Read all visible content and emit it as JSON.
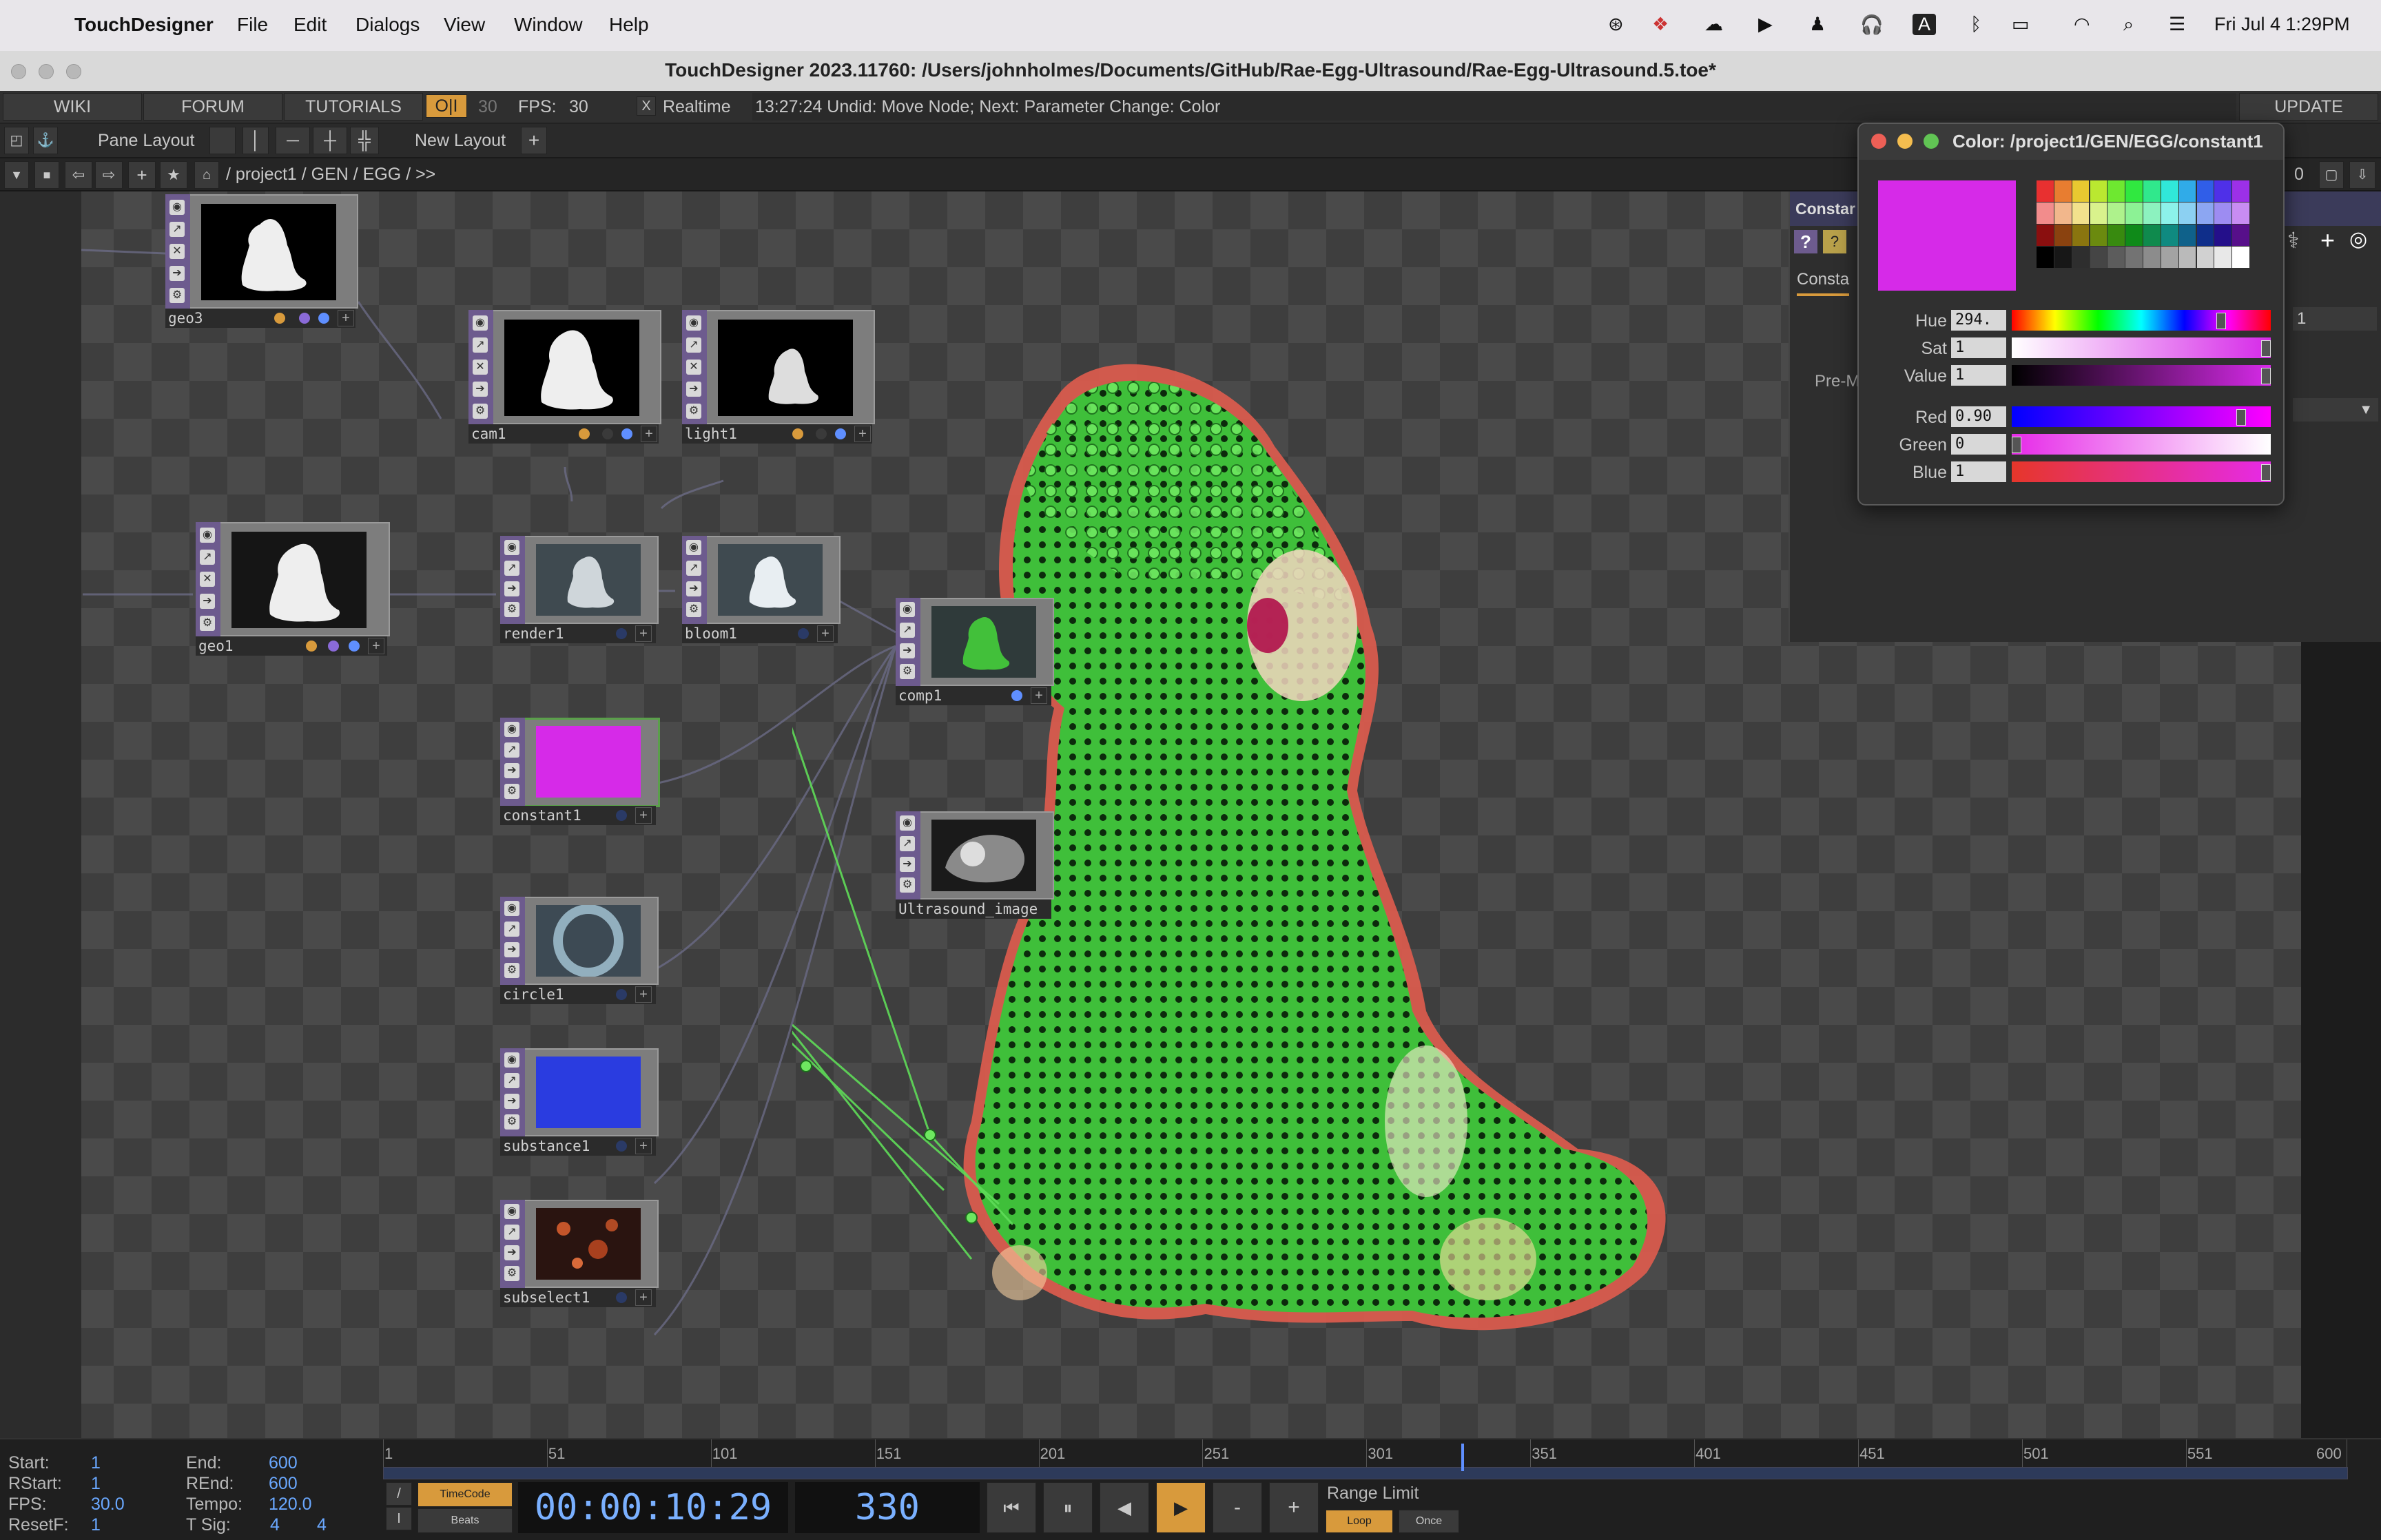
{
  "menubar": {
    "app_name": "TouchDesigner",
    "menus": [
      "File",
      "Edit",
      "Dialogs",
      "View",
      "Window",
      "Help"
    ],
    "clock": "Fri Jul 4  1:29PM",
    "input_indicator": "A"
  },
  "window": {
    "title": "TouchDesigner 2023.11760: /Users/johnholmes/Documents/GitHub/Rae-Egg-Ultrasound/Rae-Egg-Ultrasound.5.toe*"
  },
  "toolbar1": {
    "wiki": "WIKI",
    "forum": "FORUM",
    "tutorials": "TUTORIALS",
    "oi": "O|I",
    "fps_target": "30",
    "fps_label": "FPS:",
    "fps_value": "30",
    "realtime_check": "X",
    "realtime": "Realtime",
    "status": "13:27:24 Undid: Move Node; Next: Parameter Change: Color",
    "update": "UPDATE"
  },
  "toolbar2": {
    "pane_layout": "Pane Layout",
    "new_layout": "New Layout",
    "add": "+"
  },
  "toolbar3": {
    "path": "/ project1 / GEN / EGG / >>",
    "right_value": "0"
  },
  "nodes": [
    {
      "name": "geo3"
    },
    {
      "name": "cam1"
    },
    {
      "name": "light1"
    },
    {
      "name": "geo1"
    },
    {
      "name": "render1"
    },
    {
      "name": "bloom1"
    },
    {
      "name": "comp1"
    },
    {
      "name": "constant1"
    },
    {
      "name": "Ultrasound_image"
    },
    {
      "name": "circle1"
    },
    {
      "name": "substance1"
    },
    {
      "name": "subselect1"
    }
  ],
  "color_dialog": {
    "title": "Color:  /project1/GEN/EGG/constant1",
    "swatch_color": "#d62ae8",
    "rows": [
      {
        "label": "Hue",
        "value": "294.",
        "fraction": 0.82
      },
      {
        "label": "Sat",
        "value": "1",
        "fraction": 1.0
      },
      {
        "label": "Value",
        "value": "1",
        "fraction": 1.0
      },
      {
        "label": "Red",
        "value": "0.90",
        "fraction": 0.9
      },
      {
        "label": "Green",
        "value": "0",
        "fraction": 0.0
      },
      {
        "label": "Blue",
        "value": "1",
        "fraction": 1.0
      }
    ]
  },
  "param_panel": {
    "header": "Constar",
    "tab": "Consta",
    "field_label": "Pre-M",
    "field_value": "1",
    "help_icon": "?"
  },
  "timeline": {
    "start_label": "Start:",
    "start_value": "1",
    "rstart_label": "RStart:",
    "rstart_value": "1",
    "fps_label": "FPS:",
    "fps_value": "30.0",
    "resetf_label": "ResetF:",
    "resetf_value": "1",
    "end_label": "End:",
    "end_value": "600",
    "rend_label": "REnd:",
    "rend_value": "600",
    "tempo_label": "Tempo:",
    "tempo_value": "120.0",
    "tsig_label": "T Sig:",
    "tsig_value1": "4",
    "tsig_value2": "4",
    "ticks": [
      "1",
      "51",
      "101",
      "151",
      "201",
      "251",
      "301",
      "351",
      "401",
      "451",
      "501",
      "551",
      "600"
    ],
    "timecode_label": "TimeCode",
    "beats_label": "Beats",
    "timecode": "00:00:10:29",
    "frame": "330",
    "minus": "-",
    "plus": "+",
    "range_limit": "Range Limit",
    "loop": "Loop",
    "once": "Once",
    "playhead_frame": 330
  },
  "colors": {
    "accent_orange": "#d89a3c",
    "magenta": "#d62ae8",
    "green_point": "#35c53a",
    "blue_timecode": "#6aa8ff"
  }
}
